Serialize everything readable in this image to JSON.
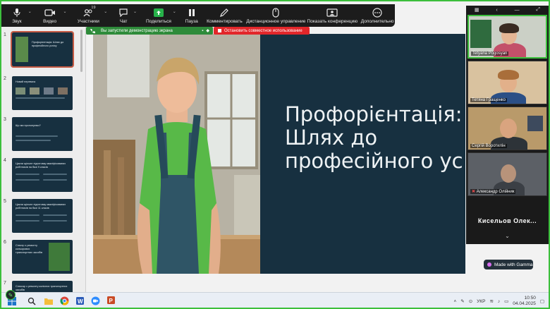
{
  "toolbar": {
    "items": [
      {
        "label": "Звук",
        "icon": "microphone-icon"
      },
      {
        "label": "Видео",
        "icon": "video-camera-icon"
      },
      {
        "label": "Участники",
        "icon": "participants-icon",
        "badge": "19"
      },
      {
        "label": "Чат",
        "icon": "chat-icon"
      },
      {
        "label": "Поделиться",
        "icon": "share-screen-icon"
      },
      {
        "label": "Пауза",
        "icon": "pause-icon"
      },
      {
        "label": "Комментировать",
        "icon": "pencil-icon"
      },
      {
        "label": "Дистанционное управление",
        "icon": "mouse-icon"
      },
      {
        "label": "Показать конференцию",
        "icon": "show-meeting-icon"
      },
      {
        "label": "Дополнительно",
        "icon": "more-icon"
      }
    ]
  },
  "share_bar": {
    "text": "Вы запустили демонстрацию экрана"
  },
  "stop_share": {
    "label": "Остановить совместное использование"
  },
  "slides": {
    "numbers": [
      "1",
      "2",
      "3",
      "4",
      "5",
      "6",
      "7"
    ],
    "thumbs": [
      {
        "title": "Профорієнтація: Шлях до професійного успіху"
      },
      {
        "title": "Новий перевага"
      },
      {
        "title": "Що ми пропонуємо?"
      },
      {
        "title": "Цикли щільне підготовку кваліфікованих робітників на базі 9 класів"
      },
      {
        "title": "Цикли щільне підготовку кваліфікованих робітників на базі 11 класів"
      },
      {
        "title": "Спектр з ремонту кольорових транспортних засобів"
      },
      {
        "title": "Слюсар з ремонту колісних транспортних засобів"
      }
    ]
  },
  "main_slide": {
    "title_lines": [
      "Профорієнтація:",
      "Шлях до",
      "професійного ус"
    ]
  },
  "gamma_badge": "Made with Gamma",
  "gallery": {
    "participants": [
      {
        "name": "Tetyana Pogosyan"
      },
      {
        "name": "Тетяна Гращенко"
      },
      {
        "name": "Сергій Воротилін"
      },
      {
        "name": "Александр Олійник"
      }
    ],
    "names_row": "Кисельов   Олек...",
    "more": "⌄"
  },
  "taskbar": {
    "lang": "УКР",
    "time": "10:50",
    "date": "04.04.2025"
  },
  "colors": {
    "slide_bg": "#173040",
    "share_green": "#2e8b3a",
    "stop_red": "#e2262a",
    "frame_green": "#3cbf3c"
  }
}
